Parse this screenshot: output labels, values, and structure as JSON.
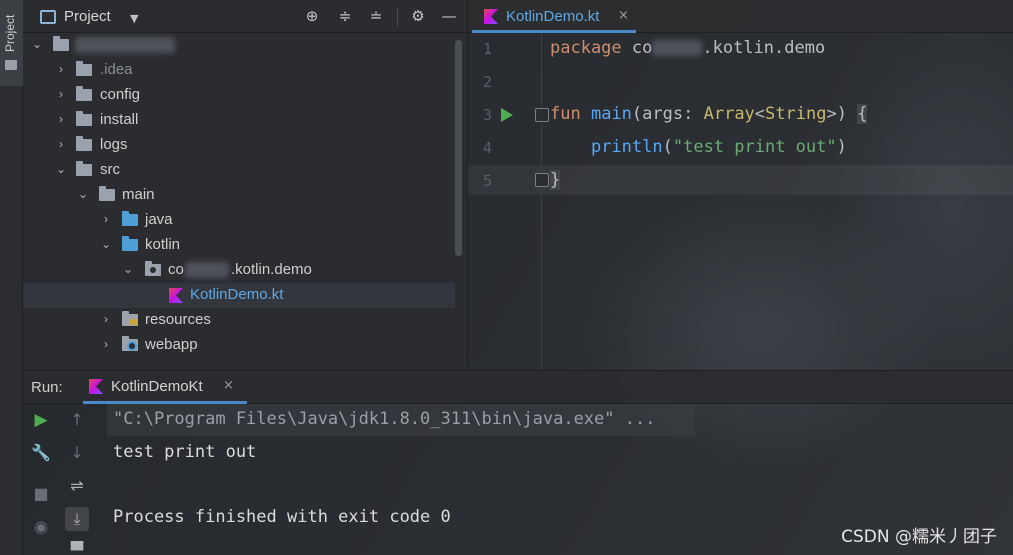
{
  "tool_strip": {
    "project_tab_label": "Project"
  },
  "project_panel": {
    "title": "Project",
    "tree": [
      {
        "label": ".idea",
        "kind": "folder",
        "expanded": false
      },
      {
        "label": "config",
        "kind": "folder",
        "expanded": false
      },
      {
        "label": "install",
        "kind": "folder",
        "expanded": false
      },
      {
        "label": "logs",
        "kind": "folder",
        "expanded": false
      },
      {
        "label": "src",
        "kind": "folder",
        "expanded": true
      },
      {
        "label": "main",
        "kind": "folder",
        "expanded": true
      },
      {
        "label": "java",
        "kind": "source-folder",
        "expanded": false
      },
      {
        "label": "kotlin",
        "kind": "source-folder",
        "expanded": true
      },
      {
        "label_prefix": "co",
        "label_suffix": ".kotlin.demo",
        "kind": "package",
        "expanded": true
      },
      {
        "label": "KotlinDemo.kt",
        "kind": "kotlin-file"
      },
      {
        "label": "resources",
        "kind": "resources-folder",
        "expanded": false
      },
      {
        "label": "webapp",
        "kind": "web-folder",
        "expanded": false
      }
    ]
  },
  "editor": {
    "tab_label": "KotlinDemo.kt",
    "tab_close": "×",
    "lines": [
      {
        "n": "1",
        "keyword": "package",
        "text_a": "co",
        "text_b": ".kotlin.demo"
      },
      {
        "n": "2"
      },
      {
        "n": "3",
        "keyword": "fun",
        "fn_name": "main",
        "open": "(",
        "param": "args",
        "colon": ": ",
        "type_a": "Array",
        "lt": "<",
        "type_b": "String",
        "gt": ">",
        "close": ") ",
        "brace": "{"
      },
      {
        "n": "4",
        "indent": "    ",
        "fn_name": "println",
        "open": "(",
        "string": "\"test print out\"",
        "close": ")"
      },
      {
        "n": "5",
        "brace": "}"
      }
    ]
  },
  "run_panel": {
    "label": "Run:",
    "tab_label": "KotlinDemoKt",
    "tab_close": "×",
    "console_lines": [
      "\"C:\\Program Files\\Java\\jdk1.8.0_311\\bin\\java.exe\" ...",
      "test print out",
      "",
      "Process finished with exit code 0"
    ]
  },
  "watermark": "CSDN @糯米丿团子",
  "colors": {
    "accent": "#4a88c7",
    "kotlin_file_text": "#5fa8e8",
    "keyword": "#cf8e6d",
    "function": "#56a8f5",
    "type": "#c7b96a",
    "string": "#6aab73",
    "run_green": "#4fae4f"
  }
}
